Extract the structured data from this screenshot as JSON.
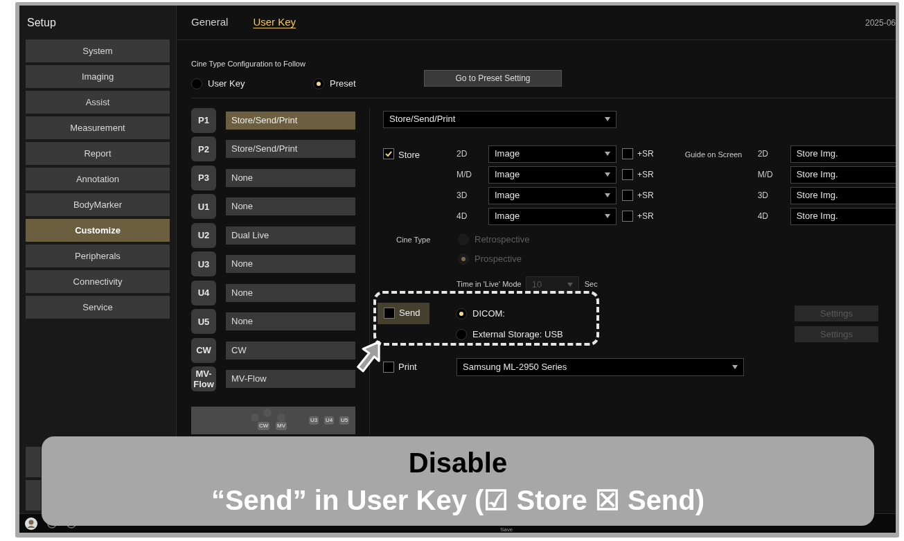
{
  "sidebar": {
    "title": "Setup",
    "items": [
      {
        "label": "System",
        "selected": false
      },
      {
        "label": "Imaging",
        "selected": false
      },
      {
        "label": "Assist",
        "selected": false
      },
      {
        "label": "Measurement",
        "selected": false
      },
      {
        "label": "Report",
        "selected": false
      },
      {
        "label": "Annotation",
        "selected": false
      },
      {
        "label": "BodyMarker",
        "selected": false
      },
      {
        "label": "Customize",
        "selected": true
      },
      {
        "label": "Peripherals",
        "selected": false
      },
      {
        "label": "Connectivity",
        "selected": false
      },
      {
        "label": "Service",
        "selected": false
      }
    ]
  },
  "tabs": [
    {
      "label": "General",
      "selected": false
    },
    {
      "label": "User Key",
      "selected": true
    }
  ],
  "date": "2025-06",
  "cine_config": {
    "label": "Cine Type Configuration to Follow",
    "options": [
      {
        "label": "User Key",
        "selected": false
      },
      {
        "label": "Preset",
        "selected": true
      }
    ],
    "button": "Go to Preset Setting"
  },
  "user_keys": [
    {
      "key": "P1",
      "value": "Store/Send/Print",
      "selected": true
    },
    {
      "key": "P2",
      "value": "Store/Send/Print",
      "selected": false
    },
    {
      "key": "P3",
      "value": "None",
      "selected": false
    },
    {
      "key": "U1",
      "value": "None",
      "selected": false
    },
    {
      "key": "U2",
      "value": "Dual Live",
      "selected": false
    },
    {
      "key": "U3",
      "value": "None",
      "selected": false
    },
    {
      "key": "U4",
      "value": "None",
      "selected": false
    },
    {
      "key": "U5",
      "value": "None",
      "selected": false
    },
    {
      "key": "CW",
      "value": "CW",
      "selected": false
    },
    {
      "key": "MV-Flow",
      "value": "MV-Flow",
      "selected": false
    }
  ],
  "keypad_labels": [
    "CW",
    "MV",
    "U3",
    "U4",
    "U5"
  ],
  "function": "Store/Send/Print",
  "store": {
    "label": "Store",
    "checked": true,
    "rows": [
      {
        "mode": "2D",
        "value": "Image",
        "sr_label": "+SR",
        "sr_checked": false
      },
      {
        "mode": "M/D",
        "value": "Image",
        "sr_label": "+SR",
        "sr_checked": false
      },
      {
        "mode": "3D",
        "value": "Image",
        "sr_label": "+SR",
        "sr_checked": false
      },
      {
        "mode": "4D",
        "value": "Image",
        "sr_label": "+SR",
        "sr_checked": false
      }
    ]
  },
  "guide": {
    "label": "Guide on Screen",
    "rows": [
      {
        "mode": "2D",
        "value": "Store Img."
      },
      {
        "mode": "M/D",
        "value": "Store Img."
      },
      {
        "mode": "3D",
        "value": "Store Img."
      },
      {
        "mode": "4D",
        "value": "Store Img."
      }
    ]
  },
  "cine_type": {
    "label": "Cine Type",
    "options": [
      {
        "label": "Retrospective",
        "selected": false,
        "disabled": true
      },
      {
        "label": "Prospective",
        "selected": true,
        "disabled": true
      }
    ]
  },
  "live_time": {
    "label": "Time in 'Live' Mode",
    "value": "10",
    "unit": "Sec",
    "disabled": true
  },
  "send": {
    "label": "Send",
    "checked": false,
    "options": [
      {
        "label": "DICOM:",
        "selected": true,
        "settings": "Settings",
        "settings_disabled": true
      },
      {
        "label": "External Storage: USB",
        "selected": false,
        "settings": "Settings",
        "settings_disabled": true
      }
    ]
  },
  "print": {
    "label": "Print",
    "checked": false,
    "printer": "Samsung ML-2950 Series"
  },
  "status_bar": {
    "save": "Save"
  },
  "caption": {
    "title": "Disable",
    "text": "“Send” in User Key (☑ Store ☒ Send)"
  }
}
